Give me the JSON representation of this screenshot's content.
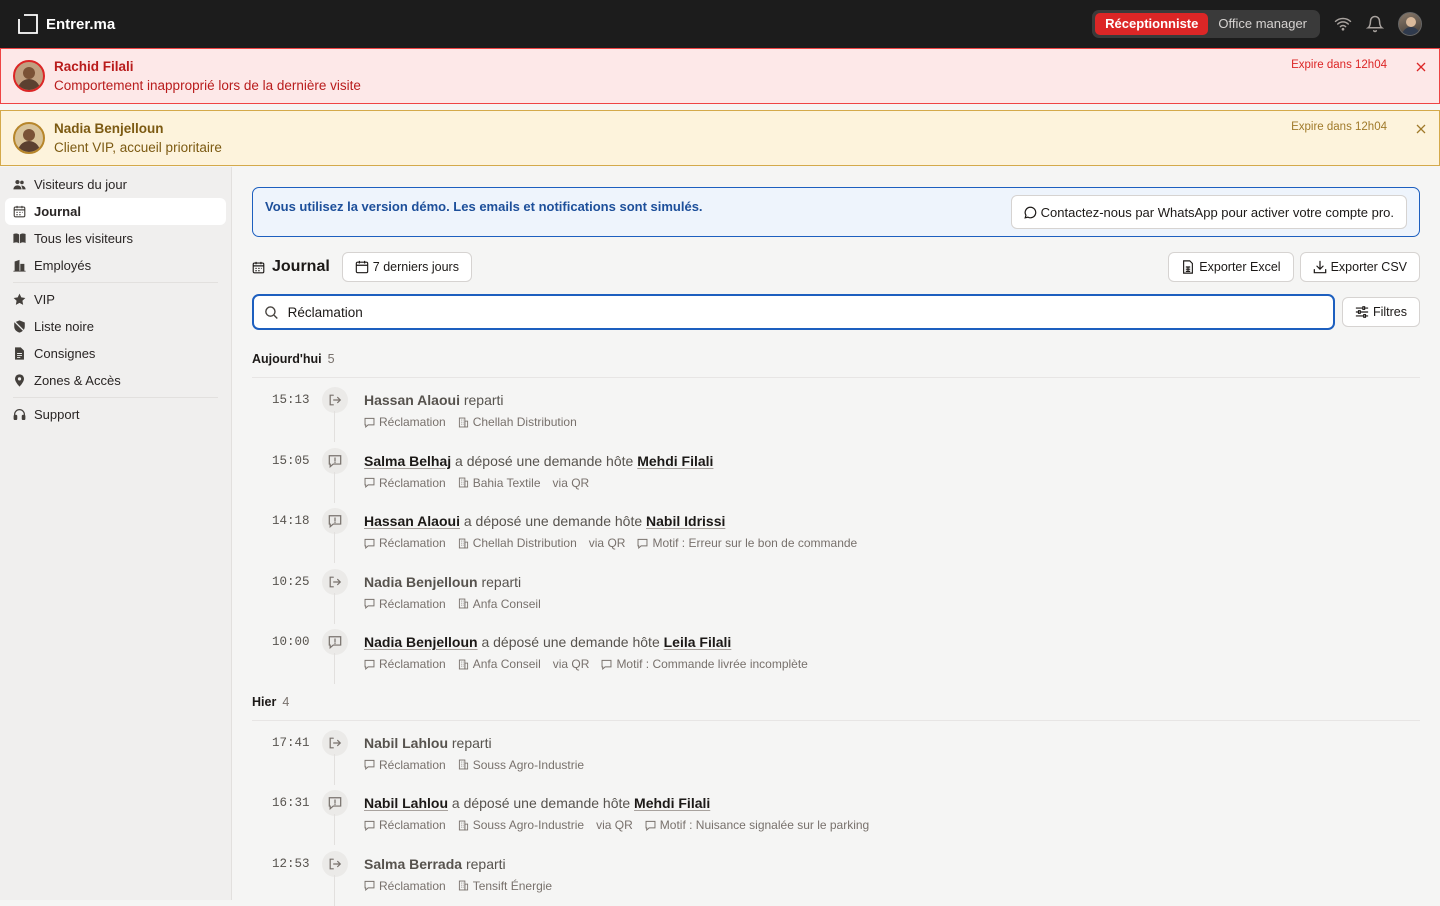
{
  "app": {
    "name": "Entrer.ma"
  },
  "roles": [
    {
      "label": "Réceptionniste",
      "active": true
    },
    {
      "label": "Office manager",
      "active": false
    }
  ],
  "alerts": [
    {
      "name": "Rachid Filali",
      "description": "Comportement inapproprié lors de la dernière visite",
      "expires": "Expire dans 12h04",
      "level": "red"
    },
    {
      "name": "Nadia Benjelloun",
      "description": "Client VIP, accueil prioritaire",
      "expires": "Expire dans 12h04",
      "level": "yellow"
    }
  ],
  "sidebar": {
    "items": [
      {
        "label": "Visiteurs du jour",
        "icon": "users-icon"
      },
      {
        "label": "Journal",
        "icon": "calendar-icon",
        "active": true
      },
      {
        "label": "Tous les visiteurs",
        "icon": "book-icon"
      },
      {
        "label": "Employés",
        "icon": "building-icon"
      },
      {
        "label": "VIP",
        "icon": "star-icon"
      },
      {
        "label": "Liste noire",
        "icon": "shield-off-icon"
      },
      {
        "label": "Consignes",
        "icon": "document-icon"
      },
      {
        "label": "Zones & Accès",
        "icon": "map-pin-icon"
      },
      {
        "label": "Support",
        "icon": "headset-icon"
      }
    ]
  },
  "demo_banner": {
    "text": "Vous utilisez la version démo. Les emails et notifications sont simulés.",
    "whatsapp_label": "Contactez-nous par WhatsApp pour activer votre compte pro."
  },
  "journal": {
    "title": "Journal",
    "range_label": "7 derniers jours",
    "export_excel": "Exporter Excel",
    "export_csv": "Exporter CSV",
    "search_value": "Réclamation",
    "filters_label": "Filtres"
  },
  "groups": [
    {
      "label": "Aujourd'hui",
      "count": "5",
      "events": [
        {
          "time": "15:13",
          "type": "leave",
          "visitor": "Hassan Alaoui",
          "verb": "reparti",
          "host": "",
          "tag": "Réclamation",
          "company": "Chellah Distribution",
          "via": "",
          "motif": ""
        },
        {
          "time": "15:05",
          "type": "request",
          "visitor": "Salma Belhaj",
          "verb": "a déposé une demande hôte",
          "host": "Mehdi Filali",
          "tag": "Réclamation",
          "company": "Bahia Textile",
          "via": "via QR",
          "motif": ""
        },
        {
          "time": "14:18",
          "type": "request",
          "visitor": "Hassan Alaoui",
          "verb": "a déposé une demande hôte",
          "host": "Nabil Idrissi",
          "tag": "Réclamation",
          "company": "Chellah Distribution",
          "via": "via QR",
          "motif": "Motif : Erreur sur le bon de commande"
        },
        {
          "time": "10:25",
          "type": "leave",
          "visitor": "Nadia Benjelloun",
          "verb": "reparti",
          "host": "",
          "tag": "Réclamation",
          "company": "Anfa Conseil",
          "via": "",
          "motif": ""
        },
        {
          "time": "10:00",
          "type": "request",
          "visitor": "Nadia Benjelloun",
          "verb": "a déposé une demande hôte",
          "host": "Leila Filali",
          "tag": "Réclamation",
          "company": "Anfa Conseil",
          "via": "via QR",
          "motif": "Motif : Commande livrée incomplète"
        }
      ]
    },
    {
      "label": "Hier",
      "count": "4",
      "events": [
        {
          "time": "17:41",
          "type": "leave",
          "visitor": "Nabil Lahlou",
          "verb": "reparti",
          "host": "",
          "tag": "Réclamation",
          "company": "Souss Agro-Industrie",
          "via": "",
          "motif": ""
        },
        {
          "time": "16:31",
          "type": "request",
          "visitor": "Nabil Lahlou",
          "verb": "a déposé une demande hôte",
          "host": "Mehdi Filali",
          "tag": "Réclamation",
          "company": "Souss Agro-Industrie",
          "via": "via QR",
          "motif": "Motif : Nuisance signalée sur le parking"
        },
        {
          "time": "12:53",
          "type": "leave",
          "visitor": "Salma Berrada",
          "verb": "reparti",
          "host": "",
          "tag": "Réclamation",
          "company": "Tensift Énergie",
          "via": "",
          "motif": ""
        }
      ]
    }
  ],
  "colors": {
    "accent": "#dc2626",
    "primary_blue": "#1d5fbf",
    "topbar": "#1c1c1c"
  }
}
